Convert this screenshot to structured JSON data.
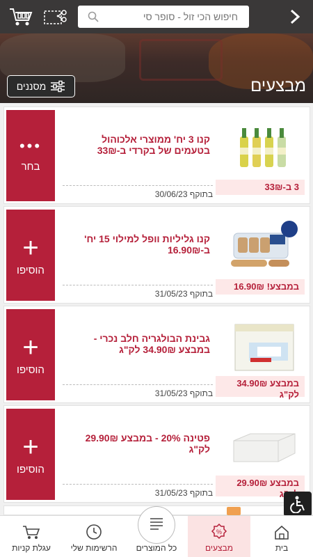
{
  "header": {
    "search_placeholder": "חיפוש הכי זול - סופר סי",
    "colors": {
      "bar": "#3a3838"
    }
  },
  "banner": {
    "title": "מבצעים",
    "filter_label": "מסננים"
  },
  "deals": [
    {
      "description": "קנו 3 יח' ממוצרי אלכוהול בטעמים של בקרדי ב-33₪",
      "valid_until": "בתוקף 30/06/23",
      "price_badge": "3 ב-33₪",
      "action_label": "בחר",
      "action_icon": "more-dots-icon"
    },
    {
      "description": "קנו גליליות וופל למילוי 15 יח' ב-16.90₪",
      "valid_until": "בתוקף 31/05/23",
      "price_badge": "במבצע! 16.90₪",
      "action_label": "הוסיפו",
      "action_icon": "plus-icon"
    },
    {
      "description": "גבינת הבולגריה חלב נכרי - במבצע 34.90₪ לק\"ג",
      "valid_until": "בתוקף 31/05/23",
      "price_badge": "במבצע 34.90₪ לק\"ג",
      "action_label": "הוסיפו",
      "action_icon": "plus-icon"
    },
    {
      "description": "פטינה 20% - במבצע 29.90₪ לק\"ג",
      "valid_until": "בתוקף 31/05/23",
      "price_badge": "במבצע 29.90₪ לק\"ג",
      "action_label": "הוסיפו",
      "action_icon": "plus-icon"
    }
  ],
  "bottom_nav": [
    {
      "label": "עגלת קניות",
      "icon": "shopping-cart-icon"
    },
    {
      "label": "הרשימות שלי",
      "icon": "clock-icon"
    },
    {
      "label": "כל המוצרים",
      "icon": "catalog-icon"
    },
    {
      "label": "מבצעים",
      "icon": "percent-badge-icon",
      "active": true
    },
    {
      "label": "בית",
      "icon": "home-icon"
    }
  ],
  "colors": {
    "accent": "#b5203a",
    "price_bg": "#fde8e8",
    "active_tab_bg": "#fbe3e3"
  }
}
